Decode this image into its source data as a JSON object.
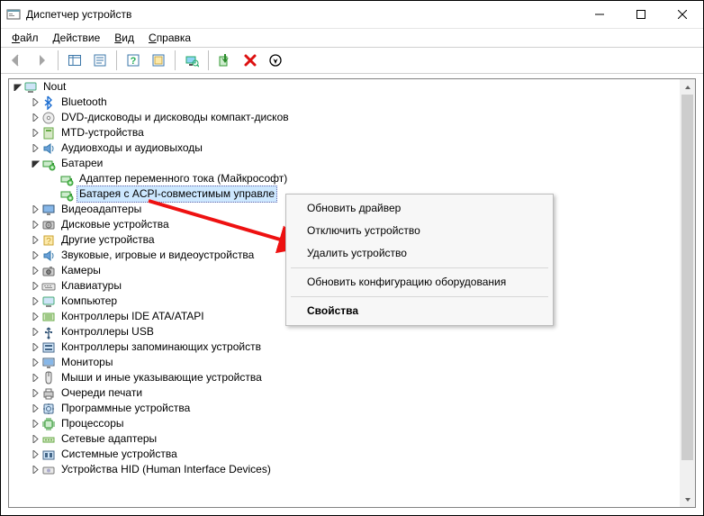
{
  "window": {
    "title": "Диспетчер устройств"
  },
  "menu": {
    "file": "Файл",
    "action": "Действие",
    "view": "Вид",
    "help": "Справка"
  },
  "tree": {
    "root": "Nout",
    "nodes": [
      {
        "icon": "bluetooth",
        "label": "Bluetooth"
      },
      {
        "icon": "disc",
        "label": "DVD-дисководы и дисководы компакт-дисков"
      },
      {
        "icon": "mtd",
        "label": "MTD-устройства"
      },
      {
        "icon": "audio",
        "label": "Аудиовходы и аудиовыходы"
      },
      {
        "icon": "battery",
        "label": "Батареи",
        "expanded": true,
        "children": [
          {
            "icon": "battery",
            "label": "Адаптер переменного тока (Майкрософт)"
          },
          {
            "icon": "battery",
            "label": "Батарея с ACPI-совместимым управле",
            "selected": true
          }
        ]
      },
      {
        "icon": "display",
        "label": "Видеоадаптеры"
      },
      {
        "icon": "disk",
        "label": "Дисковые устройства"
      },
      {
        "icon": "other",
        "label": "Другие устройства"
      },
      {
        "icon": "audio",
        "label": "Звуковые, игровые и видеоустройства"
      },
      {
        "icon": "camera",
        "label": "Камеры"
      },
      {
        "icon": "keyboard",
        "label": "Клавиатуры"
      },
      {
        "icon": "computer",
        "label": "Компьютер"
      },
      {
        "icon": "ide",
        "label": "Контроллеры IDE ATA/ATAPI"
      },
      {
        "icon": "usb",
        "label": "Контроллеры USB"
      },
      {
        "icon": "storage",
        "label": "Контроллеры запоминающих устройств"
      },
      {
        "icon": "monitor",
        "label": "Мониторы"
      },
      {
        "icon": "mouse",
        "label": "Мыши и иные указывающие устройства"
      },
      {
        "icon": "printer",
        "label": "Очереди печати"
      },
      {
        "icon": "software",
        "label": "Программные устройства"
      },
      {
        "icon": "cpu",
        "label": "Процессоры"
      },
      {
        "icon": "network",
        "label": "Сетевые адаптеры"
      },
      {
        "icon": "system",
        "label": "Системные устройства"
      },
      {
        "icon": "hid",
        "label": "Устройства HID (Human Interface Devices)"
      }
    ]
  },
  "context_menu": {
    "update_driver": "Обновить драйвер",
    "disable_device": "Отключить устройство",
    "remove_device": "Удалить устройство",
    "scan_hardware": "Обновить конфигурацию оборудования",
    "properties": "Свойства"
  }
}
